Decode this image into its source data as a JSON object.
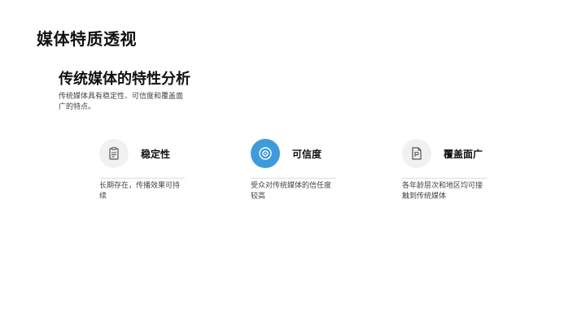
{
  "page": {
    "title": "媒体特质透视",
    "subtitle": "传统媒体的特性分析",
    "description": "传统媒体具有稳定性、可信度和覆盖面广的特点。"
  },
  "cards": [
    {
      "icon": "clipboard-icon",
      "label": "稳定性",
      "text": "长期存在，传播效果可持续",
      "active": false
    },
    {
      "icon": "target-icon",
      "label": "可信度",
      "text": "受众对传统媒体的信任度较高",
      "active": true
    },
    {
      "icon": "document-icon",
      "label": "覆盖面广",
      "text": "各年龄层次和地区均可接触到传统媒体",
      "active": false
    }
  ],
  "colors": {
    "accent": "#3d9bd9",
    "icon_bg": "#f1f1f1",
    "divider": "#dcdcdc"
  }
}
